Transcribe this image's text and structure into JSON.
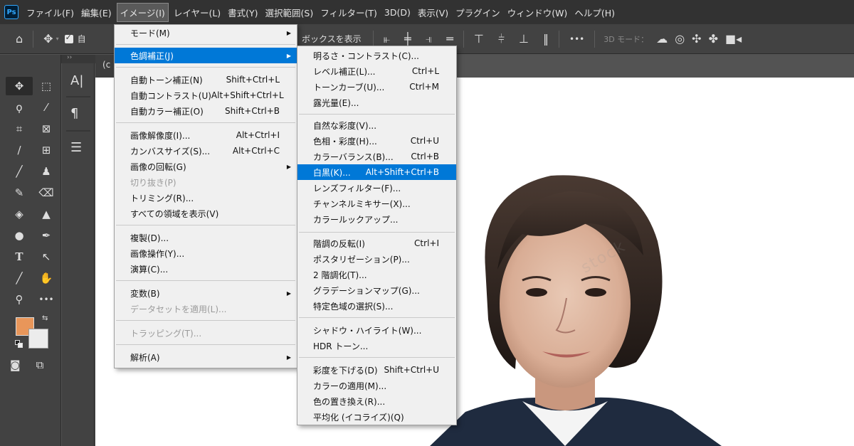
{
  "menubar": {
    "logo": "Ps",
    "items": [
      "ファイル(F)",
      "編集(E)",
      "イメージ(I)",
      "レイヤー(L)",
      "書式(Y)",
      "選択範囲(S)",
      "フィルター(T)",
      "3D(D)",
      "表示(V)",
      "プラグイン",
      "ウィンドウ(W)",
      "ヘルプ(H)"
    ],
    "active_index": 2
  },
  "options": {
    "partial_label_1": "自",
    "partial_label_2": "ボックスを表示",
    "mode_3d": "3D モード：",
    "more": "•••"
  },
  "document": {
    "tab_label": "(c"
  },
  "colors": {
    "foreground": "#e8965a",
    "background": "#ececec",
    "highlight": "#0078d7"
  },
  "image_menu": {
    "items": [
      {
        "label": "モード(M)",
        "shortcut": "",
        "submenu": true
      },
      {
        "label": "色調補正(J)",
        "shortcut": "",
        "submenu": true,
        "highlighted": true
      },
      {
        "label": "自動トーン補正(N)",
        "shortcut": "Shift+Ctrl+L"
      },
      {
        "label": "自動コントラスト(U)",
        "shortcut": "Alt+Shift+Ctrl+L"
      },
      {
        "label": "自動カラー補正(O)",
        "shortcut": "Shift+Ctrl+B"
      },
      {
        "label": "画像解像度(I)...",
        "shortcut": "Alt+Ctrl+I"
      },
      {
        "label": "カンバスサイズ(S)...",
        "shortcut": "Alt+Ctrl+C"
      },
      {
        "label": "画像の回転(G)",
        "shortcut": "",
        "submenu": true
      },
      {
        "label": "切り抜き(P)",
        "shortcut": "",
        "disabled": true
      },
      {
        "label": "トリミング(R)...",
        "shortcut": ""
      },
      {
        "label": "すべての領域を表示(V)",
        "shortcut": ""
      },
      {
        "label": "複製(D)...",
        "shortcut": ""
      },
      {
        "label": "画像操作(Y)...",
        "shortcut": ""
      },
      {
        "label": "演算(C)...",
        "shortcut": ""
      },
      {
        "label": "変数(B)",
        "shortcut": "",
        "submenu": true
      },
      {
        "label": "データセットを適用(L)...",
        "shortcut": "",
        "disabled": true
      },
      {
        "label": "トラッピング(T)...",
        "shortcut": "",
        "disabled": true
      },
      {
        "label": "解析(A)",
        "shortcut": "",
        "submenu": true
      }
    ]
  },
  "adjust_menu": {
    "items": [
      {
        "label": "明るさ・コントラスト(C)...",
        "shortcut": ""
      },
      {
        "label": "レベル補正(L)...",
        "shortcut": "Ctrl+L"
      },
      {
        "label": "トーンカーブ(U)...",
        "shortcut": "Ctrl+M"
      },
      {
        "label": "露光量(E)...",
        "shortcut": ""
      },
      {
        "label": "自然な彩度(V)...",
        "shortcut": ""
      },
      {
        "label": "色相・彩度(H)...",
        "shortcut": "Ctrl+U"
      },
      {
        "label": "カラーバランス(B)...",
        "shortcut": "Ctrl+B"
      },
      {
        "label": "白黒(K)...",
        "shortcut": "Alt+Shift+Ctrl+B",
        "highlighted": true
      },
      {
        "label": "レンズフィルター(F)...",
        "shortcut": ""
      },
      {
        "label": "チャンネルミキサー(X)...",
        "shortcut": ""
      },
      {
        "label": "カラールックアップ...",
        "shortcut": ""
      },
      {
        "label": "階調の反転(I)",
        "shortcut": "Ctrl+I"
      },
      {
        "label": "ポスタリゼーション(P)...",
        "shortcut": ""
      },
      {
        "label": "2 階調化(T)...",
        "shortcut": ""
      },
      {
        "label": "グラデーションマップ(G)...",
        "shortcut": ""
      },
      {
        "label": "特定色域の選択(S)...",
        "shortcut": ""
      },
      {
        "label": "シャドウ・ハイライト(W)...",
        "shortcut": ""
      },
      {
        "label": "HDR トーン...",
        "shortcut": ""
      },
      {
        "label": "彩度を下げる(D)",
        "shortcut": "Shift+Ctrl+U"
      },
      {
        "label": "カラーの適用(M)...",
        "shortcut": ""
      },
      {
        "label": "色の置き換え(R)...",
        "shortcut": ""
      },
      {
        "label": "平均化 (イコライズ)(Q)",
        "shortcut": ""
      }
    ]
  }
}
